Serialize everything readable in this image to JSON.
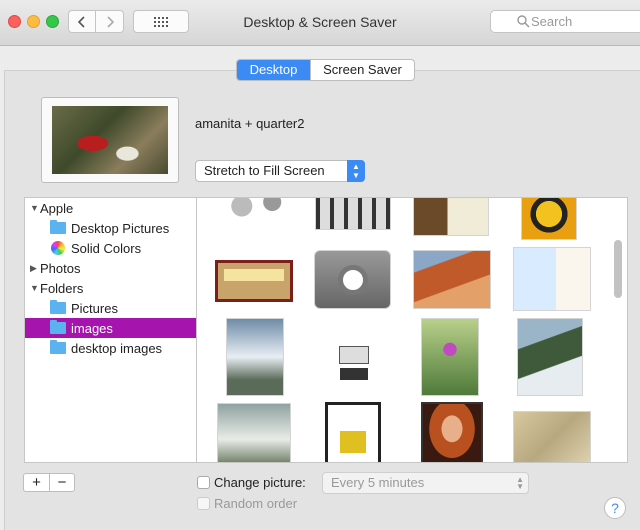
{
  "window": {
    "title": "Desktop & Screen Saver"
  },
  "search": {
    "placeholder": "Search"
  },
  "tabs": [
    {
      "label": "Desktop",
      "selected": true
    },
    {
      "label": "Screen Saver",
      "selected": false
    }
  ],
  "current": {
    "name": "amanita + quarter2",
    "fit": "Stretch to Fill Screen"
  },
  "sidebar": {
    "groups": [
      {
        "label": "Apple",
        "expanded": true,
        "items": [
          {
            "label": "Desktop Pictures",
            "icon": "folder-icon"
          },
          {
            "label": "Solid Colors",
            "icon": "color-wheel-icon"
          }
        ]
      },
      {
        "label": "Photos",
        "expanded": false,
        "items": []
      },
      {
        "label": "Folders",
        "expanded": true,
        "items": [
          {
            "label": "Pictures",
            "icon": "folder-icon"
          },
          {
            "label": "images",
            "icon": "folder-icon",
            "selected": true
          },
          {
            "label": "desktop images",
            "icon": "folder-icon"
          }
        ]
      }
    ]
  },
  "buttons": {
    "add": "+",
    "remove": "−",
    "help": "?"
  },
  "options": {
    "change_picture": {
      "label": "Change picture:",
      "checked": false
    },
    "interval": "Every 5 minutes",
    "random_order": {
      "label": "Random order",
      "checked": false,
      "enabled": false
    }
  },
  "colors": {
    "accent": "#3c8bf5",
    "selection": "#a515ad"
  }
}
